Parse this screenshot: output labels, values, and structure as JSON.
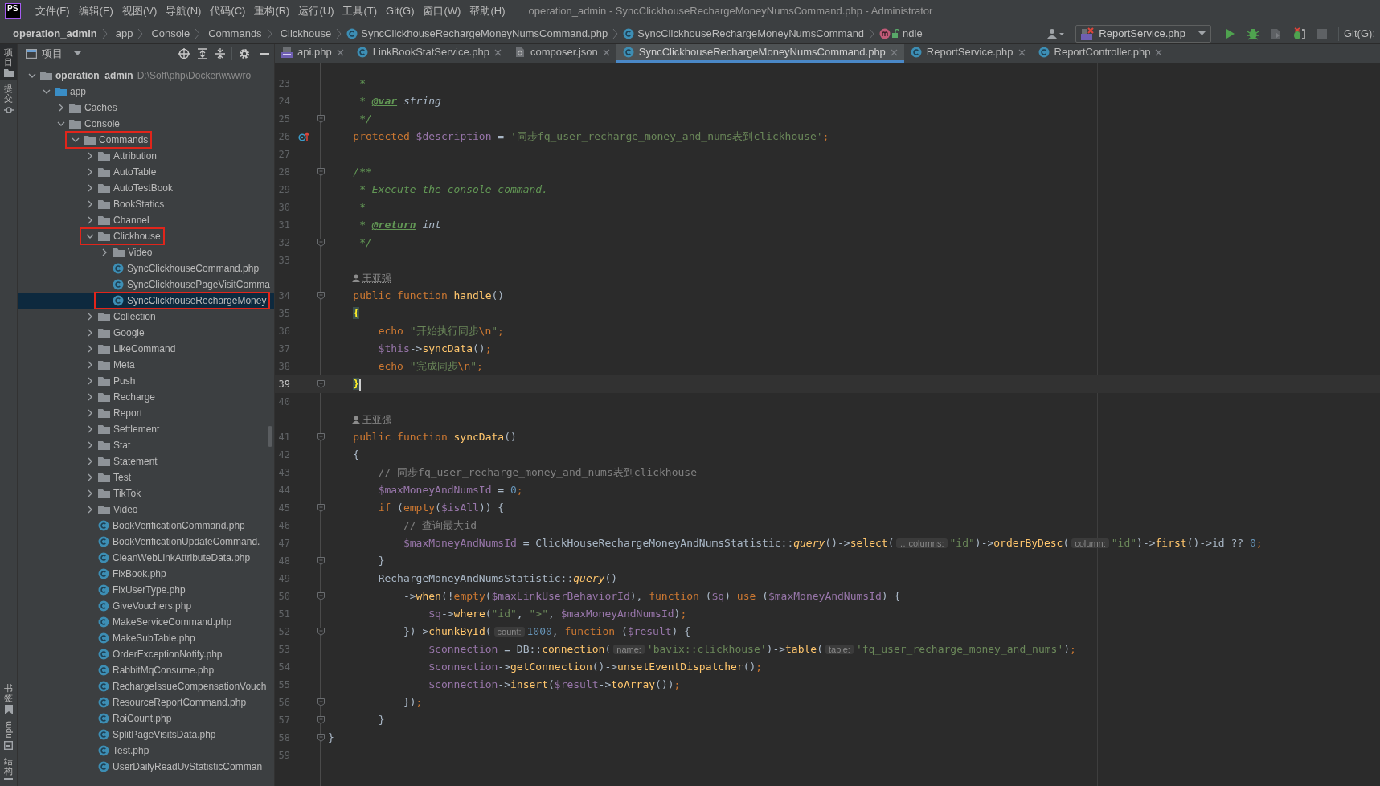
{
  "title_bar": {
    "logo": "PS",
    "menu": [
      "文件(F)",
      "编辑(E)",
      "视图(V)",
      "导航(N)",
      "代码(C)",
      "重构(R)",
      "运行(U)",
      "工具(T)",
      "Git(G)",
      "窗口(W)",
      "帮助(H)"
    ],
    "title": "operation_admin - SyncClickhouseRechargeMoneyNumsCommand.php - Administrator"
  },
  "navigation_bar": {
    "breadcrumbs": [
      {
        "label": "operation_admin",
        "kind": "project"
      },
      {
        "label": "app",
        "kind": "folder"
      },
      {
        "label": "Console",
        "kind": "folder"
      },
      {
        "label": "Commands",
        "kind": "folder"
      },
      {
        "label": "Clickhouse",
        "kind": "folder"
      },
      {
        "label": "SyncClickhouseRechargeMoneyNumsCommand.php",
        "kind": "file"
      },
      {
        "label": "SyncClickhouseRechargeMoneyNumsCommand",
        "kind": "class"
      },
      {
        "label": "ndle",
        "kind": "method"
      }
    ],
    "run_configuration": "ReportService.php",
    "vcs_label": "Git(G):"
  },
  "tool_strip": {
    "top": [
      {
        "label": "项目",
        "kind": "project",
        "selected": true
      },
      {
        "label": "提交",
        "kind": "commit",
        "selected": false
      }
    ],
    "bottom": [
      {
        "label": "书签",
        "kind": "bookmarks"
      },
      {
        "label": "npm",
        "kind": "npm"
      },
      {
        "label": "结构",
        "kind": "structure"
      }
    ]
  },
  "project_panel": {
    "title": "项目",
    "tree": [
      {
        "label": "operation_admin",
        "path": "D:\\Soft\\php\\Docker\\wwwro",
        "kind": "root",
        "expanded": true,
        "selected": false,
        "marked": false,
        "children": [
          {
            "label": "app",
            "kind": "source",
            "expanded": true,
            "selected": false,
            "marked": false,
            "children": [
              {
                "label": "Caches",
                "kind": "folder",
                "expanded": false,
                "selected": false,
                "marked": false
              },
              {
                "label": "Console",
                "kind": "folder",
                "expanded": true,
                "selected": false,
                "marked": false,
                "children": [
                  {
                    "label": "Commands",
                    "kind": "folder",
                    "expanded": true,
                    "selected": false,
                    "marked": true,
                    "children": [
                      {
                        "label": "Attribution",
                        "kind": "folder",
                        "expanded": false,
                        "selected": false,
                        "marked": false
                      },
                      {
                        "label": "AutoTable",
                        "kind": "folder",
                        "expanded": false,
                        "selected": false,
                        "marked": false
                      },
                      {
                        "label": "AutoTestBook",
                        "kind": "folder",
                        "expanded": false,
                        "selected": false,
                        "marked": false
                      },
                      {
                        "label": "BookStatics",
                        "kind": "folder",
                        "expanded": false,
                        "selected": false,
                        "marked": false
                      },
                      {
                        "label": "Channel",
                        "kind": "folder",
                        "expanded": false,
                        "selected": false,
                        "marked": false
                      },
                      {
                        "label": "Clickhouse",
                        "kind": "folder",
                        "expanded": true,
                        "selected": false,
                        "marked": true,
                        "children": [
                          {
                            "label": "Video",
                            "kind": "folder",
                            "expanded": false,
                            "selected": false,
                            "marked": false
                          },
                          {
                            "label": "SyncClickhouseCommand.php",
                            "kind": "class",
                            "selected": false,
                            "marked": false
                          },
                          {
                            "label": "SyncClickhousePageVisitComma",
                            "kind": "class",
                            "selected": false,
                            "marked": false
                          },
                          {
                            "label": "SyncClickhouseRechargeMoney",
                            "kind": "class",
                            "selected": true,
                            "marked": true
                          }
                        ]
                      },
                      {
                        "label": "Collection",
                        "kind": "folder",
                        "expanded": false,
                        "selected": false,
                        "marked": false
                      },
                      {
                        "label": "Google",
                        "kind": "folder",
                        "expanded": false,
                        "selected": false,
                        "marked": false
                      },
                      {
                        "label": "LikeCommand",
                        "kind": "folder",
                        "expanded": false,
                        "selected": false,
                        "marked": false
                      },
                      {
                        "label": "Meta",
                        "kind": "folder",
                        "expanded": false,
                        "selected": false,
                        "marked": false
                      },
                      {
                        "label": "Push",
                        "kind": "folder",
                        "expanded": false,
                        "selected": false,
                        "marked": false
                      },
                      {
                        "label": "Recharge",
                        "kind": "folder",
                        "expanded": false,
                        "selected": false,
                        "marked": false
                      },
                      {
                        "label": "Report",
                        "kind": "folder",
                        "expanded": false,
                        "selected": false,
                        "marked": false
                      },
                      {
                        "label": "Settlement",
                        "kind": "folder",
                        "expanded": false,
                        "selected": false,
                        "marked": false
                      },
                      {
                        "label": "Stat",
                        "kind": "folder",
                        "expanded": false,
                        "selected": false,
                        "marked": false
                      },
                      {
                        "label": "Statement",
                        "kind": "folder",
                        "expanded": false,
                        "selected": false,
                        "marked": false
                      },
                      {
                        "label": "Test",
                        "kind": "folder",
                        "expanded": false,
                        "selected": false,
                        "marked": false
                      },
                      {
                        "label": "TikTok",
                        "kind": "folder",
                        "expanded": false,
                        "selected": false,
                        "marked": false
                      },
                      {
                        "label": "Video",
                        "kind": "folder",
                        "expanded": false,
                        "selected": false,
                        "marked": false
                      },
                      {
                        "label": "BookVerificationCommand.php",
                        "kind": "class",
                        "selected": false,
                        "marked": false
                      },
                      {
                        "label": "BookVerificationUpdateCommand.",
                        "kind": "class",
                        "selected": false,
                        "marked": false
                      },
                      {
                        "label": "CleanWebLinkAttributeData.php",
                        "kind": "class",
                        "selected": false,
                        "marked": false
                      },
                      {
                        "label": "FixBook.php",
                        "kind": "class",
                        "selected": false,
                        "marked": false
                      },
                      {
                        "label": "FixUserType.php",
                        "kind": "class",
                        "selected": false,
                        "marked": false
                      },
                      {
                        "label": "GiveVouchers.php",
                        "kind": "class",
                        "selected": false,
                        "marked": false
                      },
                      {
                        "label": "MakeServiceCommand.php",
                        "kind": "class",
                        "selected": false,
                        "marked": false
                      },
                      {
                        "label": "MakeSubTable.php",
                        "kind": "class",
                        "selected": false,
                        "marked": false
                      },
                      {
                        "label": "OrderExceptionNotify.php",
                        "kind": "class",
                        "selected": false,
                        "marked": false
                      },
                      {
                        "label": "RabbitMqConsume.php",
                        "kind": "class",
                        "selected": false,
                        "marked": false
                      },
                      {
                        "label": "RechargeIssueCompensationVouch",
                        "kind": "class",
                        "selected": false,
                        "marked": false
                      },
                      {
                        "label": "ResourceReportCommand.php",
                        "kind": "class",
                        "selected": false,
                        "marked": false
                      },
                      {
                        "label": "RoiCount.php",
                        "kind": "class",
                        "selected": false,
                        "marked": false
                      },
                      {
                        "label": "SplitPageVisitsData.php",
                        "kind": "class",
                        "selected": false,
                        "marked": false
                      },
                      {
                        "label": "Test.php",
                        "kind": "class",
                        "selected": false,
                        "marked": false
                      },
                      {
                        "label": "UserDailyReadUvStatisticComman",
                        "kind": "class",
                        "selected": false,
                        "marked": false
                      }
                    ]
                  }
                ]
              }
            ]
          }
        ]
      }
    ]
  },
  "editor": {
    "tabs": [
      {
        "label": "api.php",
        "kind": "php",
        "selected": false
      },
      {
        "label": "LinkBookStatService.php",
        "kind": "class",
        "selected": false
      },
      {
        "label": "composer.json",
        "kind": "json",
        "selected": false
      },
      {
        "label": "SyncClickhouseRechargeMoneyNumsCommand.php",
        "kind": "class",
        "selected": true
      },
      {
        "label": "ReportService.php",
        "kind": "class",
        "selected": false
      },
      {
        "label": "ReportController.php",
        "kind": "class",
        "selected": false
      }
    ],
    "lines": [
      {
        "kind": "code",
        "number": "23",
        "fold": false,
        "current": false,
        "tokens": [
          {
            "kind": "doc",
            "text": "     *"
          }
        ]
      },
      {
        "kind": "code",
        "number": "24",
        "fold": false,
        "current": false,
        "tokens": [
          {
            "kind": "doc",
            "text": "     * "
          },
          {
            "kind": "doctag",
            "text": "@var"
          },
          {
            "kind": "doctype",
            "text": " string"
          }
        ]
      },
      {
        "kind": "code",
        "number": "25",
        "fold": true,
        "current": false,
        "tokens": [
          {
            "kind": "doc",
            "text": "     */"
          }
        ]
      },
      {
        "kind": "code",
        "number": "26",
        "fold": false,
        "current": false,
        "override": true,
        "tokens": [
          {
            "kind": "kw",
            "text": "    protected "
          },
          {
            "kind": "var",
            "text": "$description"
          },
          {
            "kind": "plain",
            "text": " = "
          },
          {
            "kind": "str",
            "text": "'同步fq_user_recharge_money_and_nums表到clickhouse'"
          },
          {
            "kind": "kw",
            "text": ";"
          }
        ]
      },
      {
        "kind": "code",
        "number": "27",
        "fold": false,
        "current": false
      },
      {
        "kind": "code",
        "number": "28",
        "fold": true,
        "current": false,
        "tokens": [
          {
            "kind": "doc",
            "text": "    /**"
          }
        ]
      },
      {
        "kind": "code",
        "number": "29",
        "fold": false,
        "current": false,
        "tokens": [
          {
            "kind": "doc",
            "text": "     * Execute the console command."
          }
        ]
      },
      {
        "kind": "code",
        "number": "30",
        "fold": false,
        "current": false,
        "tokens": [
          {
            "kind": "doc",
            "text": "     *"
          }
        ]
      },
      {
        "kind": "code",
        "number": "31",
        "fold": false,
        "current": false,
        "tokens": [
          {
            "kind": "doc",
            "text": "     * "
          },
          {
            "kind": "doctag",
            "text": "@return"
          },
          {
            "kind": "doctype",
            "text": " int"
          }
        ]
      },
      {
        "kind": "code",
        "number": "32",
        "fold": true,
        "current": false,
        "tokens": [
          {
            "kind": "doc",
            "text": "     */"
          }
        ]
      },
      {
        "kind": "code",
        "number": "33",
        "fold": false,
        "current": false
      },
      {
        "kind": "author",
        "text": "王亚强"
      },
      {
        "kind": "code",
        "number": "34",
        "fold": true,
        "current": false,
        "tokens": [
          {
            "kind": "kw",
            "text": "    public function "
          },
          {
            "kind": "fn",
            "text": "handle"
          },
          {
            "kind": "plain",
            "text": "()"
          }
        ]
      },
      {
        "kind": "code",
        "number": "35",
        "fold": false,
        "current": false,
        "tokens": [
          {
            "kind": "match",
            "text": "    {"
          }
        ]
      },
      {
        "kind": "code",
        "number": "36",
        "fold": false,
        "current": false,
        "tokens": [
          {
            "kind": "kw",
            "text": "        echo "
          },
          {
            "kind": "str",
            "text": "\"开始执行同步"
          },
          {
            "kind": "kw",
            "text": "\\n"
          },
          {
            "kind": "str",
            "text": "\""
          },
          {
            "kind": "kw",
            "text": ";"
          }
        ]
      },
      {
        "kind": "code",
        "number": "37",
        "fold": false,
        "current": false,
        "tokens": [
          {
            "kind": "var",
            "text": "        $this"
          },
          {
            "kind": "plain",
            "text": "->"
          },
          {
            "kind": "fn",
            "text": "syncData"
          },
          {
            "kind": "plain",
            "text": "()"
          },
          {
            "kind": "kw",
            "text": ";"
          }
        ]
      },
      {
        "kind": "code",
        "number": "38",
        "fold": false,
        "current": false,
        "tokens": [
          {
            "kind": "kw",
            "text": "        echo "
          },
          {
            "kind": "str",
            "text": "\"完成同步"
          },
          {
            "kind": "kw",
            "text": "\\n"
          },
          {
            "kind": "str",
            "text": "\""
          },
          {
            "kind": "kw",
            "text": ";"
          }
        ]
      },
      {
        "kind": "code",
        "number": "39",
        "fold": true,
        "current": true,
        "tokens": [
          {
            "kind": "match",
            "text": "    }"
          }
        ]
      },
      {
        "kind": "code",
        "number": "40",
        "fold": false,
        "current": false
      },
      {
        "kind": "author",
        "text": "王亚强"
      },
      {
        "kind": "code",
        "number": "41",
        "fold": true,
        "current": false,
        "tokens": [
          {
            "kind": "kw",
            "text": "    public function "
          },
          {
            "kind": "fn",
            "text": "syncData"
          },
          {
            "kind": "plain",
            "text": "()"
          }
        ]
      },
      {
        "kind": "code",
        "number": "42",
        "fold": false,
        "current": false,
        "tokens": [
          {
            "kind": "plain",
            "text": "    {"
          }
        ]
      },
      {
        "kind": "code",
        "number": "43",
        "fold": false,
        "current": false,
        "tokens": [
          {
            "kind": "comment",
            "text": "        // 同步fq_user_recharge_money_and_nums表到clickhouse"
          }
        ]
      },
      {
        "kind": "code",
        "number": "44",
        "fold": false,
        "current": false,
        "tokens": [
          {
            "kind": "var",
            "text": "        $maxMoneyAndNumsId"
          },
          {
            "kind": "plain",
            "text": " = "
          },
          {
            "kind": "num",
            "text": "0"
          },
          {
            "kind": "kw",
            "text": ";"
          }
        ]
      },
      {
        "kind": "code",
        "number": "45",
        "fold": true,
        "current": false,
        "tokens": [
          {
            "kind": "kw",
            "text": "        if "
          },
          {
            "kind": "plain",
            "text": "("
          },
          {
            "kind": "kw",
            "text": "empty"
          },
          {
            "kind": "plain",
            "text": "("
          },
          {
            "kind": "var",
            "text": "$isAll"
          },
          {
            "kind": "plain",
            "text": ")) {"
          }
        ]
      },
      {
        "kind": "code",
        "number": "46",
        "fold": false,
        "current": false,
        "tokens": [
          {
            "kind": "comment",
            "text": "            // 查询最大id"
          }
        ]
      },
      {
        "kind": "code",
        "number": "47",
        "fold": false,
        "current": false,
        "tokens": [
          {
            "kind": "var",
            "text": "            $maxMoneyAndNumsId"
          },
          {
            "kind": "plain",
            "text": " = ClickHouseRechargeMoneyAndNumsStatistic::"
          },
          {
            "kind": "static",
            "text": "query"
          },
          {
            "kind": "plain",
            "text": "()->"
          },
          {
            "kind": "fn",
            "text": "select"
          },
          {
            "kind": "plain",
            "text": "("
          },
          {
            "kind": "hint",
            "text": "…columns:"
          },
          {
            "kind": "str",
            "text": "\"id\""
          },
          {
            "kind": "plain",
            "text": ")->"
          },
          {
            "kind": "fn",
            "text": "orderByDesc"
          },
          {
            "kind": "plain",
            "text": "("
          },
          {
            "kind": "hint",
            "text": "column:"
          },
          {
            "kind": "str",
            "text": "\"id\""
          },
          {
            "kind": "plain",
            "text": ")->"
          },
          {
            "kind": "fn",
            "text": "first"
          },
          {
            "kind": "plain",
            "text": "()->id ?? "
          },
          {
            "kind": "num",
            "text": "0"
          },
          {
            "kind": "kw",
            "text": ";"
          }
        ]
      },
      {
        "kind": "code",
        "number": "48",
        "fold": true,
        "current": false,
        "tokens": [
          {
            "kind": "plain",
            "text": "        }"
          }
        ]
      },
      {
        "kind": "code",
        "number": "49",
        "fold": false,
        "current": false,
        "tokens": [
          {
            "kind": "plain",
            "text": "        RechargeMoneyAndNumsStatistic::"
          },
          {
            "kind": "static",
            "text": "query"
          },
          {
            "kind": "plain",
            "text": "()"
          }
        ]
      },
      {
        "kind": "code",
        "number": "50",
        "fold": true,
        "current": false,
        "tokens": [
          {
            "kind": "plain",
            "text": "            ->"
          },
          {
            "kind": "fn",
            "text": "when"
          },
          {
            "kind": "plain",
            "text": "(!"
          },
          {
            "kind": "kw",
            "text": "empty"
          },
          {
            "kind": "plain",
            "text": "("
          },
          {
            "kind": "var",
            "text": "$maxLinkUserBehaviorId"
          },
          {
            "kind": "plain",
            "text": "), "
          },
          {
            "kind": "kw",
            "text": "function "
          },
          {
            "kind": "plain",
            "text": "("
          },
          {
            "kind": "var",
            "text": "$q"
          },
          {
            "kind": "plain",
            "text": ") "
          },
          {
            "kind": "kw",
            "text": "use "
          },
          {
            "kind": "plain",
            "text": "("
          },
          {
            "kind": "var",
            "text": "$maxMoneyAndNumsId"
          },
          {
            "kind": "plain",
            "text": ") {"
          }
        ]
      },
      {
        "kind": "code",
        "number": "51",
        "fold": false,
        "current": false,
        "tokens": [
          {
            "kind": "var",
            "text": "                $q"
          },
          {
            "kind": "plain",
            "text": "->"
          },
          {
            "kind": "fn",
            "text": "where"
          },
          {
            "kind": "plain",
            "text": "("
          },
          {
            "kind": "str",
            "text": "\"id\""
          },
          {
            "kind": "plain",
            "text": ", "
          },
          {
            "kind": "str",
            "text": "\">\""
          },
          {
            "kind": "plain",
            "text": ", "
          },
          {
            "kind": "var",
            "text": "$maxMoneyAndNumsId"
          },
          {
            "kind": "plain",
            "text": ")"
          },
          {
            "kind": "kw",
            "text": ";"
          }
        ]
      },
      {
        "kind": "code",
        "number": "52",
        "fold": true,
        "current": false,
        "tokens": [
          {
            "kind": "plain",
            "text": "            })->"
          },
          {
            "kind": "fn",
            "text": "chunkById"
          },
          {
            "kind": "plain",
            "text": "("
          },
          {
            "kind": "hint",
            "text": "count:"
          },
          {
            "kind": "num",
            "text": "1000"
          },
          {
            "kind": "plain",
            "text": ", "
          },
          {
            "kind": "kw",
            "text": "function "
          },
          {
            "kind": "plain",
            "text": "("
          },
          {
            "kind": "var",
            "text": "$result"
          },
          {
            "kind": "plain",
            "text": ") {"
          }
        ]
      },
      {
        "kind": "code",
        "number": "53",
        "fold": false,
        "current": false,
        "tokens": [
          {
            "kind": "var",
            "text": "                $connection"
          },
          {
            "kind": "plain",
            "text": " = DB::"
          },
          {
            "kind": "fn",
            "text": "connection"
          },
          {
            "kind": "plain",
            "text": "("
          },
          {
            "kind": "hint",
            "text": "name:"
          },
          {
            "kind": "str",
            "text": "'bavix::clickhouse'"
          },
          {
            "kind": "plain",
            "text": ")->"
          },
          {
            "kind": "fn",
            "text": "table"
          },
          {
            "kind": "plain",
            "text": "("
          },
          {
            "kind": "hint",
            "text": "table:"
          },
          {
            "kind": "str",
            "text": "'fq_user_recharge_money_and_nums'"
          },
          {
            "kind": "plain",
            "text": ")"
          },
          {
            "kind": "kw",
            "text": ";"
          }
        ]
      },
      {
        "kind": "code",
        "number": "54",
        "fold": false,
        "current": false,
        "tokens": [
          {
            "kind": "var",
            "text": "                $connection"
          },
          {
            "kind": "plain",
            "text": "->"
          },
          {
            "kind": "fn",
            "text": "getConnection"
          },
          {
            "kind": "plain",
            "text": "()->"
          },
          {
            "kind": "fn",
            "text": "unsetEventDispatcher"
          },
          {
            "kind": "plain",
            "text": "()"
          },
          {
            "kind": "kw",
            "text": ";"
          }
        ]
      },
      {
        "kind": "code",
        "number": "55",
        "fold": false,
        "current": false,
        "tokens": [
          {
            "kind": "var",
            "text": "                $connection"
          },
          {
            "kind": "plain",
            "text": "->"
          },
          {
            "kind": "fn",
            "text": "insert"
          },
          {
            "kind": "plain",
            "text": "("
          },
          {
            "kind": "var",
            "text": "$result"
          },
          {
            "kind": "plain",
            "text": "->"
          },
          {
            "kind": "fn",
            "text": "toArray"
          },
          {
            "kind": "plain",
            "text": "())"
          },
          {
            "kind": "kw",
            "text": ";"
          }
        ]
      },
      {
        "kind": "code",
        "number": "56",
        "fold": true,
        "current": false,
        "tokens": [
          {
            "kind": "plain",
            "text": "            })"
          },
          {
            "kind": "kw",
            "text": ";"
          }
        ]
      },
      {
        "kind": "code",
        "number": "57",
        "fold": true,
        "current": false,
        "tokens": [
          {
            "kind": "plain",
            "text": "        }"
          }
        ]
      },
      {
        "kind": "code",
        "number": "58",
        "fold": true,
        "current": false,
        "tokens": [
          {
            "kind": "plain",
            "text": "}"
          }
        ]
      },
      {
        "kind": "code",
        "number": "59",
        "fold": false,
        "current": false
      }
    ]
  }
}
